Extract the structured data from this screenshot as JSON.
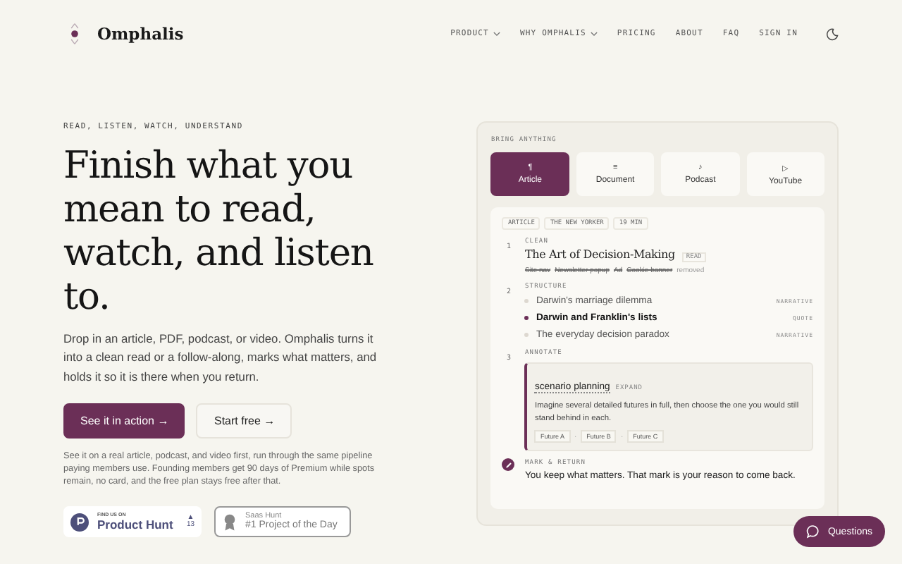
{
  "brand": {
    "name": "Omphalis"
  },
  "nav": [
    {
      "label": "PRODUCT",
      "dropdown": true
    },
    {
      "label": "WHY OMPHALIS",
      "dropdown": true
    },
    {
      "label": "PRICING",
      "dropdown": false
    },
    {
      "label": "ABOUT",
      "dropdown": false
    },
    {
      "label": "FAQ",
      "dropdown": false
    },
    {
      "label": "SIGN IN",
      "dropdown": false
    }
  ],
  "hero": {
    "eyebrow": "READ, LISTEN, WATCH, UNDERSTAND",
    "headline": "Finish what you mean to read, watch, and listen to.",
    "lead": "Drop in an article, PDF, podcast, or video. Omphalis turns it into a clean read or a follow-along, marks what matters, and holds it so it is there when you return.",
    "primary_button": "See it in action →",
    "secondary_button": "Start free →",
    "note": "See it on a real article, podcast, and video first, run through the same pipeline paying members use. Founding members get 90 days of Premium while spots remain, no card, and the free plan stays free after that."
  },
  "badges": {
    "product_hunt": {
      "kicker": "FIND US ON",
      "name": "Product Hunt",
      "arrow": "▲",
      "count": "13"
    },
    "saas_hunt": {
      "kicker": "Saas Hunt",
      "title": "#1 Project of the Day"
    }
  },
  "demo": {
    "label": "BRING ANYTHING",
    "tabs": [
      {
        "glyph": "¶",
        "label": "Article",
        "selected": true
      },
      {
        "glyph": "≡",
        "label": "Document",
        "selected": false
      },
      {
        "glyph": "♪",
        "label": "Podcast",
        "selected": false
      },
      {
        "glyph": "▷",
        "label": "YouTube",
        "selected": false
      }
    ],
    "tags": [
      "ARTICLE",
      "THE NEW YORKER",
      "19 MIN"
    ],
    "steps": [
      {
        "kind": "clean",
        "number": "1",
        "label": "CLEAN",
        "title": "The Art of Decision-Making",
        "badge": "READ",
        "removed": [
          "Site nav",
          "Newsletter popup",
          "Ad",
          "Cookie banner"
        ],
        "removed_suffix": "removed"
      },
      {
        "kind": "structure",
        "number": "2",
        "label": "STRUCTURE",
        "items": [
          {
            "text": "Darwin's marriage dilemma",
            "tag": "NARRATIVE",
            "selected": false
          },
          {
            "text": "Darwin and Franklin's lists",
            "tag": "QUOTE",
            "selected": true
          },
          {
            "text": "The everyday decision paradox",
            "tag": "NARRATIVE",
            "selected": false
          }
        ]
      },
      {
        "kind": "annotate",
        "number": "3",
        "label": "ANNOTATE",
        "term": "scenario planning",
        "action": "EXPAND",
        "body": "Imagine several detailed futures in full, then choose the one you would still stand behind in each.",
        "chips": [
          "Future A",
          "Future B",
          "Future C"
        ],
        "separator": "·"
      },
      {
        "kind": "mark",
        "label": "MARK & RETURN",
        "text": "You keep what matters. That mark is your reason to come back."
      }
    ]
  },
  "chat_button": "Questions"
}
